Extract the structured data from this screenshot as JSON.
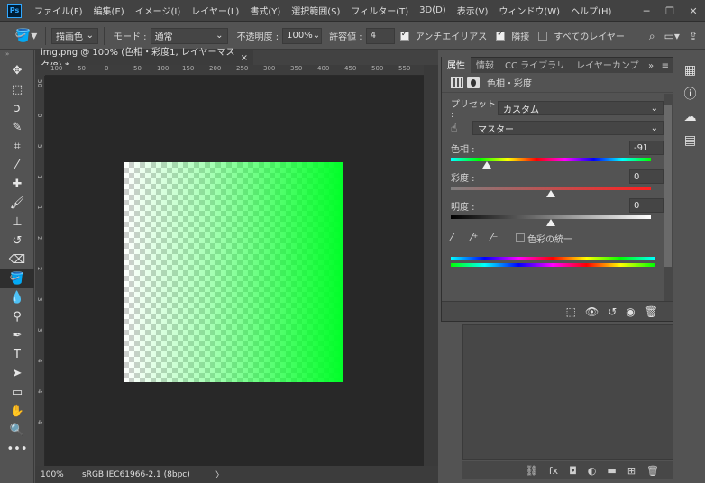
{
  "menubar": {
    "logo": "Ps",
    "items": [
      "ファイル(F)",
      "編集(E)",
      "イメージ(I)",
      "レイヤー(L)",
      "書式(Y)",
      "選択範囲(S)",
      "フィルター(T)",
      "3D(D)",
      "表示(V)",
      "ウィンドウ(W)",
      "ヘルプ(H)"
    ],
    "win_minimize": "─",
    "win_maximize": "❐",
    "win_close": "✕"
  },
  "options": {
    "mode_preset": "描画色",
    "mode_label": "モード :",
    "mode_value": "通常",
    "opacity_label": "不透明度 :",
    "opacity_value": "100%",
    "tolerance_label": "許容値 :",
    "tolerance_value": "4",
    "antialias_label": "アンチエイリアス",
    "contiguous_label": "隣接",
    "all_layers_label": "すべてのレイヤー"
  },
  "document": {
    "tab_title": "img.png @ 100% (色相・彩度1, レイヤーマスク/8) *",
    "tab_close": "×",
    "ruler_h_ticks": [
      "100",
      "50",
      "0",
      "50",
      "100",
      "150",
      "200",
      "250",
      "300",
      "350",
      "400",
      "450",
      "500",
      "550"
    ],
    "ruler_v_ticks": [
      "50",
      "0",
      "5",
      "1",
      "1",
      "2",
      "2",
      "3",
      "3",
      "4",
      "4",
      "4"
    ],
    "zoom": "100%",
    "doc_info": "sRGB IEC61966-2.1 (8bpc)",
    "status_arrow": "〉"
  },
  "properties": {
    "tabs": [
      "属性",
      "情報",
      "CC ライブラリ",
      "レイヤーカンプ"
    ],
    "tabs_more": "»",
    "title": "色相・彩度",
    "preset_label": "プリセット :",
    "preset_value": "カスタム",
    "channel_value": "マスター",
    "hue_label": "色相 :",
    "hue_value": "-91",
    "hue_fraction": 0.18,
    "saturation_label": "彩度 :",
    "saturation_value": "0",
    "saturation_fraction": 0.5,
    "lightness_label": "明度 :",
    "lightness_value": "0",
    "lightness_fraction": 0.5,
    "colorize_label": "色彩の統一"
  },
  "colors": {
    "accent": "#31a8ff",
    "canvas_bg": "#282828",
    "green": "#00ff28"
  }
}
